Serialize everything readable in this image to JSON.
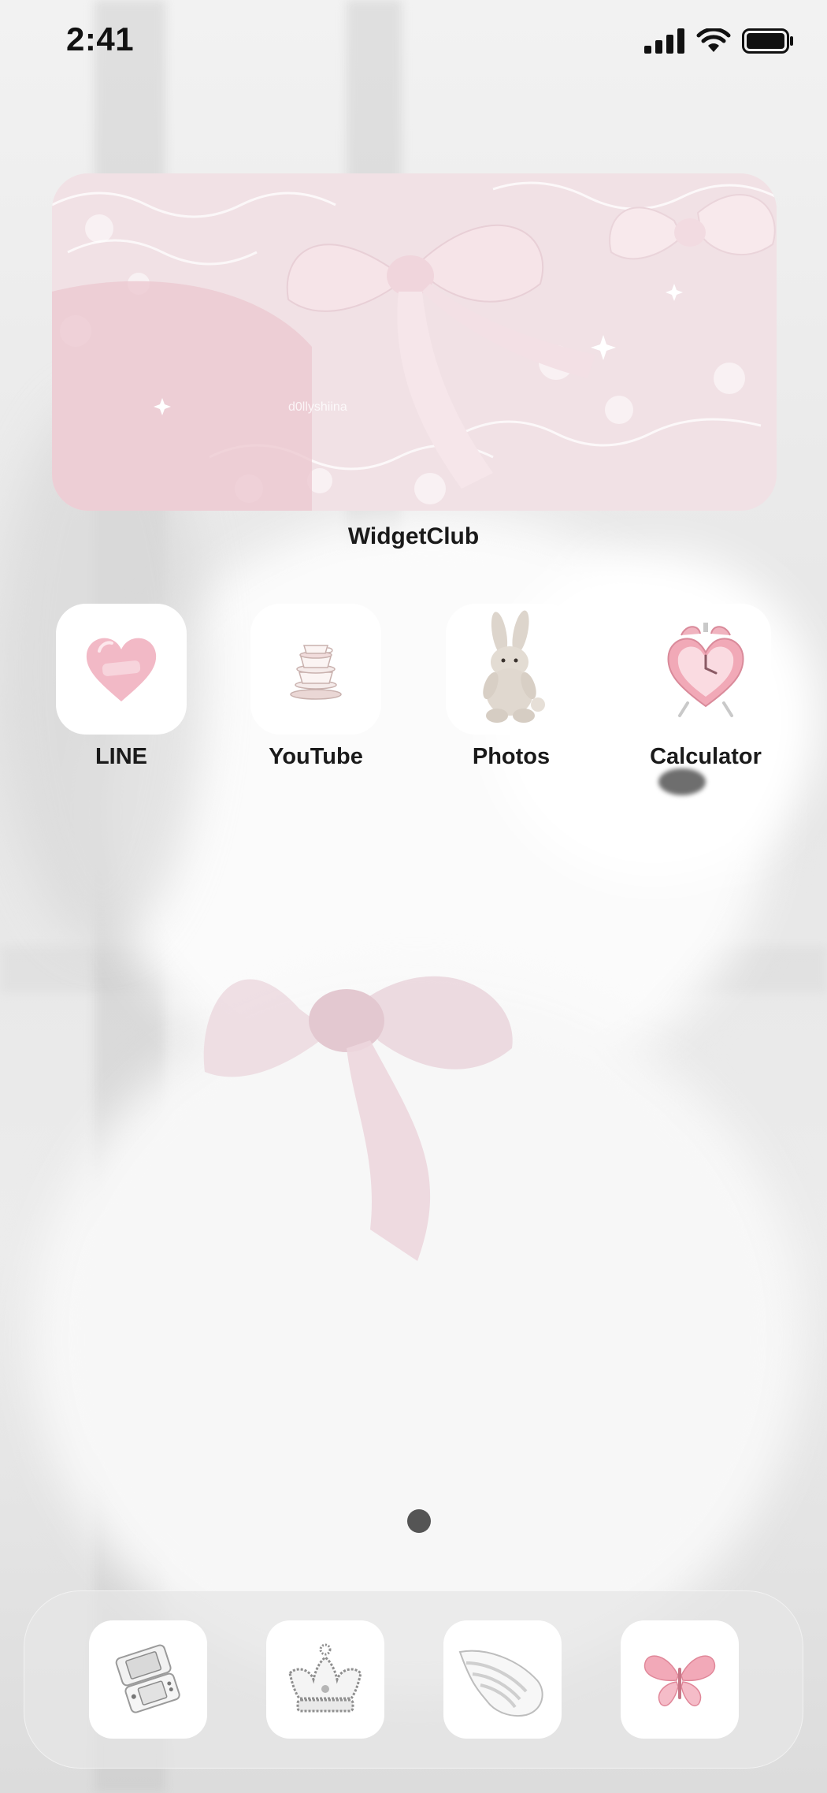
{
  "status_bar": {
    "time": "2:41"
  },
  "widget": {
    "caption": "WidgetClub",
    "watermark": "d0llyshiina"
  },
  "apps": [
    {
      "label": "LINE",
      "icon": "pink-heart-icon"
    },
    {
      "label": "YouTube",
      "icon": "teacup-stack-icon"
    },
    {
      "label": "Photos",
      "icon": "bunny-plush-icon"
    },
    {
      "label": "Calculator",
      "icon": "heart-alarm-clock-icon"
    }
  ],
  "dock": [
    {
      "icon": "handheld-console-icon"
    },
    {
      "icon": "crown-icon"
    },
    {
      "icon": "angel-wing-icon"
    },
    {
      "icon": "pink-butterfly-icon"
    }
  ],
  "page_indicator": {
    "pages": 1,
    "current": 1
  },
  "colors": {
    "accent_pink": "#f2b9c6",
    "label": "#1a1a1a",
    "dock": "#e6e6e6"
  }
}
